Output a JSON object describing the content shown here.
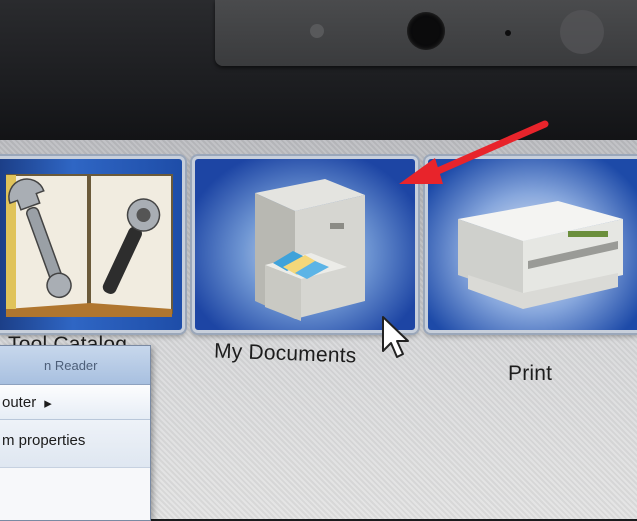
{
  "desktop": {
    "tiles": [
      {
        "id": "tool-catalog",
        "label": "Tool Catalog"
      },
      {
        "id": "my-documents",
        "label": "My Documents"
      },
      {
        "id": "print",
        "label": "Print"
      }
    ]
  },
  "window": {
    "title": "n Reader",
    "breadcrumb": "outer",
    "breadcrumb_arrow": "▸",
    "menu_item": "m properties"
  },
  "annotation": {
    "arrow_color": "#e8242b"
  },
  "colors": {
    "tile_blue": "#1d45a4",
    "tile_border": "#c7cfdb"
  }
}
